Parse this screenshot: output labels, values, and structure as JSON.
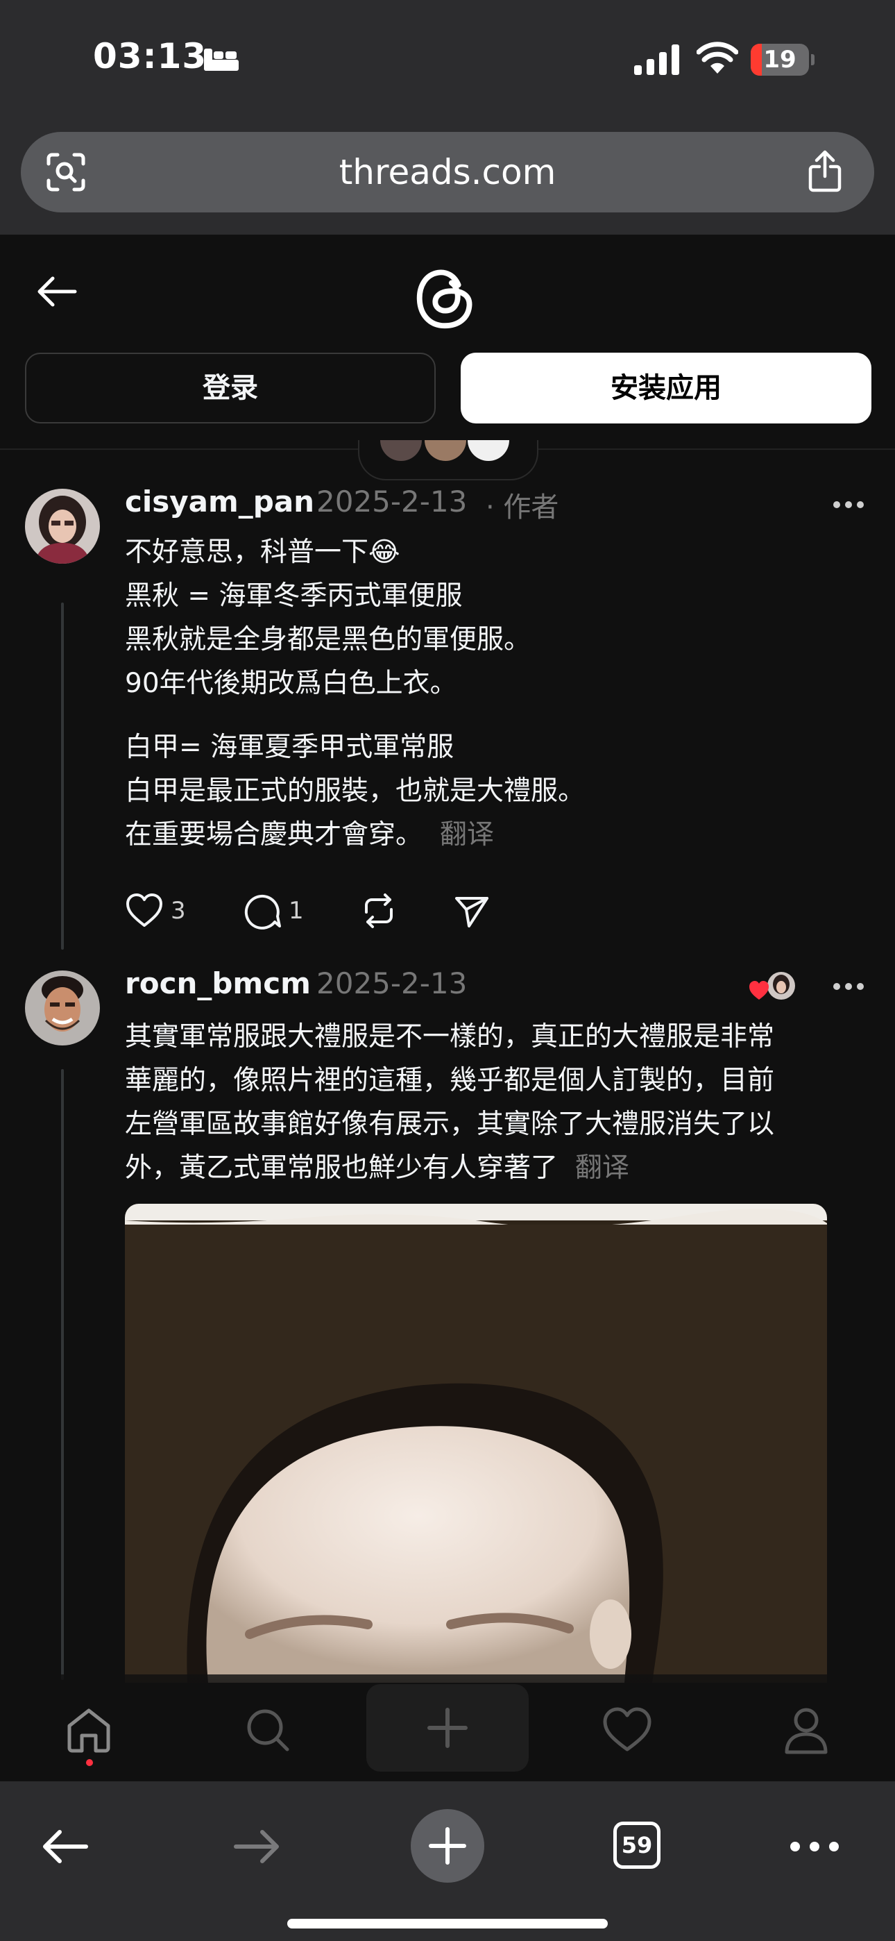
{
  "status_bar": {
    "time": "03:13",
    "battery_level": "19",
    "battery_fraction": 0.19,
    "icons": [
      "sleep-focus-icon",
      "cellular-signal-icon",
      "wifi-icon",
      "battery-icon"
    ]
  },
  "address_bar": {
    "url": "threads.com",
    "left_icon": "visual-lookup-icon",
    "right_icon": "share-icon"
  },
  "header": {
    "back_icon": "back-arrow-icon",
    "logo": "threads-logo-icon",
    "login_label": "登录",
    "install_label": "安装应用"
  },
  "posts": [
    {
      "username": "cisyam_pan",
      "date": "2025-2-13",
      "author_tag": "· 作者",
      "paragraphs": [
        [
          "不好意思，科普一下😂",
          "黑秋 = 海軍冬季丙式軍便服",
          "黑秋就是全身都是黑色的軍便服。",
          "90年代後期改爲白色上衣。"
        ],
        [
          "白甲= 海軍夏季甲式軍常服",
          "白甲是最正式的服裝，也就是大禮服。",
          "在重要場合慶典才會穿。"
        ]
      ],
      "translate_label": "翻译",
      "likes": "3",
      "replies": "1"
    },
    {
      "username": "rocn_bmcm",
      "date": "2025-2-13",
      "liked_by_author": true,
      "paragraphs": [
        [
          "其實軍常服跟大禮服是不一樣的，真正的大禮服是非常",
          "華麗的，像照片裡的這種，幾乎都是個人訂製的，目前",
          "左營軍區故事館好像有展示，其實除了大禮服消失了以",
          "外，黃乙式軍常服也鮮少有人穿著了"
        ]
      ],
      "translate_label": "翻译",
      "has_photo": true
    }
  ],
  "threads_nav": {
    "items": [
      "home-icon",
      "search-icon",
      "compose-icon",
      "activity-icon",
      "profile-icon"
    ],
    "active": "home-icon"
  },
  "browser_toolbar": {
    "back_icon": "back-icon",
    "forward_icon": "forward-icon",
    "new_tab_icon": "new-tab-icon",
    "tab_count": "59",
    "more_icon": "more-icon"
  },
  "colors": {
    "background": "#101010",
    "browser_chrome": "#2c2c2e",
    "secondary_text": "#777777",
    "battery_low": "#ff3b30",
    "like_red": "#ff3040"
  }
}
